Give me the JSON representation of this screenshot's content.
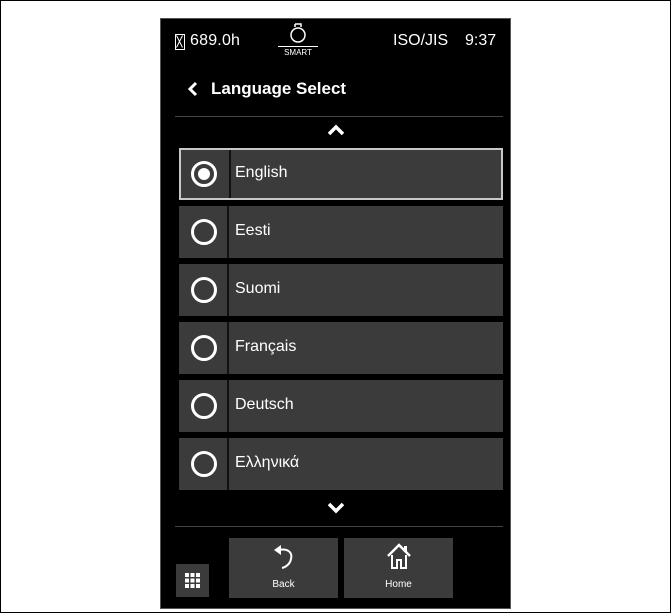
{
  "status_bar": {
    "hours": "689.0h",
    "smart_label": "SMART",
    "standard": "ISO/JIS",
    "time": "9:37"
  },
  "header": {
    "title": "Language Select"
  },
  "languages": [
    {
      "label": "English",
      "selected": true
    },
    {
      "label": "Eesti",
      "selected": false
    },
    {
      "label": "Suomi",
      "selected": false
    },
    {
      "label": "Français",
      "selected": false
    },
    {
      "label": "Deutsch",
      "selected": false
    },
    {
      "label": "Ελληνικά",
      "selected": false
    }
  ],
  "nav": {
    "back_label": "Back",
    "home_label": "Home"
  },
  "icons": {
    "hour_meter": "hourglass-icon",
    "smart": "smart-mode-icon",
    "back": "chevron-left-icon",
    "scroll_up": "chevron-up-icon",
    "scroll_down": "chevron-down-icon",
    "menu": "grid-menu-icon",
    "back_nav": "undo-arrow-icon",
    "home_nav": "home-icon"
  },
  "colors": {
    "screen_bg": "#000000",
    "item_bg": "#3b3b3b",
    "selected_border": "#c8c8c8",
    "text": "#ffffff"
  }
}
